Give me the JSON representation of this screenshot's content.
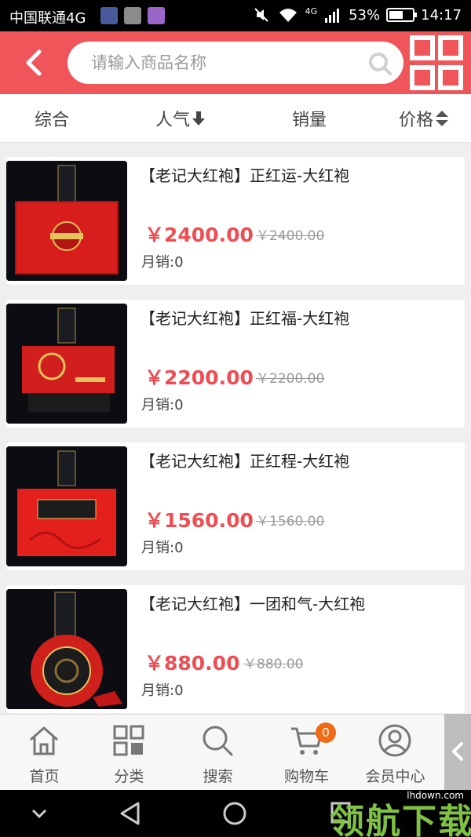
{
  "status_bar": {
    "carrier": "中国联通4G",
    "network": "4G",
    "battery": "53%",
    "battery_level": 0.53,
    "time": "14:17"
  },
  "header": {
    "search_placeholder": "请输入商品名称",
    "icons": {
      "back": "back-arrow-icon",
      "search": "search-icon",
      "qr": "qr-code-icon"
    }
  },
  "sort_bar": {
    "tabs": [
      {
        "label": "综合"
      },
      {
        "label": "人气",
        "icon": "arrow-down-icon"
      },
      {
        "label": "销量"
      },
      {
        "label": "价格",
        "icon": "sort-updown-icon"
      }
    ]
  },
  "products": [
    {
      "name": "【老记大红袍】正红运-大红袍",
      "price": "￥2400.00",
      "original_price": "￥2400.00",
      "sales": "月销:0"
    },
    {
      "name": "【老记大红袍】正红福-大红袍",
      "price": "￥2200.00",
      "original_price": "￥2200.00",
      "sales": "月销:0"
    },
    {
      "name": "【老记大红袍】正红程-大红袍",
      "price": "￥1560.00",
      "original_price": "￥1560.00",
      "sales": "月销:0"
    },
    {
      "name": "【老记大红袍】一团和气-大红袍",
      "price": "￥880.00",
      "original_price": "￥880.00",
      "sales": "月销:0"
    }
  ],
  "bottom_nav": {
    "items": [
      {
        "label": "首页",
        "icon": "home-icon"
      },
      {
        "label": "分类",
        "icon": "category-grid-icon"
      },
      {
        "label": "搜索",
        "icon": "search-icon"
      },
      {
        "label": "购物车",
        "icon": "cart-icon",
        "badge": "0"
      },
      {
        "label": "会员中心",
        "icon": "user-icon"
      }
    ]
  },
  "watermark": {
    "url": "lhdown.com",
    "text": "领航下载"
  },
  "colors": {
    "brand": "#f0555a",
    "price": "#ef4d52",
    "badge": "#f06a16"
  }
}
